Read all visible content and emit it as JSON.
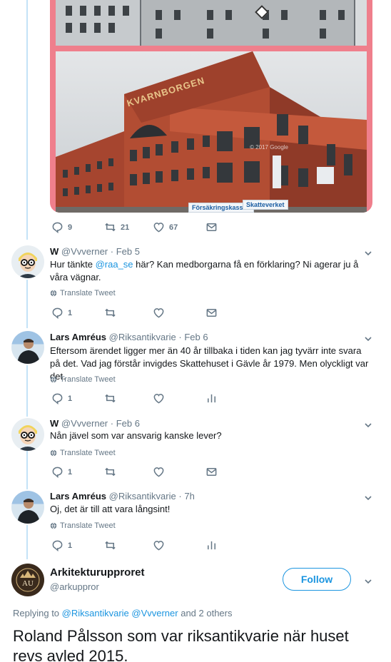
{
  "colors": {
    "accent": "#1b95e0",
    "muted": "#657786",
    "thread": "#c4e3f7",
    "card_bg": "#ef7f8c"
  },
  "photo": {
    "building_sign": "KVARNBORGEN",
    "watermark": "© 2017 Google",
    "shop_signs": [
      "Försäkringskassan",
      "Skatteverket"
    ]
  },
  "top_actions": {
    "reply_count": "9",
    "retweet_count": "21",
    "like_count": "67"
  },
  "tweets": [
    {
      "name": "W",
      "handle": "@Vvverner",
      "date": "Feb 5",
      "text_before": "Hur tänkte ",
      "mention": "@raa_se",
      "text_after": " här? Kan medborgarna få en förklaring? Ni agerar ju å våra vägnar.",
      "translate": "Translate Tweet",
      "reply_count": "1"
    },
    {
      "name": "Lars Amréus",
      "handle": "@Riksantikvarie",
      "date": "Feb 6",
      "text": "Eftersom ärendet ligger mer än 40 år tillbaka i tiden kan jag tyvärr inte svara på det. Vad jag förstår invigdes Skattehuset i Gävle år 1979. Men olyckligt var det.",
      "translate": "Translate Tweet",
      "reply_count": "1"
    },
    {
      "name": "W",
      "handle": "@Vvverner",
      "date": "Feb 6",
      "text": "Nån jävel som var ansvarig kanske lever?",
      "translate": "Translate Tweet",
      "reply_count": "1"
    },
    {
      "name": "Lars Amréus",
      "handle": "@Riksantikvarie",
      "date": "7h",
      "text": "Oj, det är till att vara långsint!",
      "translate": "Translate Tweet",
      "reply_count": "1"
    }
  ],
  "author": {
    "name": "Arkitekturupproret",
    "handle": "@arkuppror",
    "avatar_initials": "AU",
    "follow_label": "Follow"
  },
  "replying": {
    "prefix": "Replying to ",
    "mentions": "@Riksantikvarie @Vvverner",
    "suffix": " and 2 others"
  },
  "main_tweet": "Roland Pålsson som var riksantikvarie när huset revs avled 2015."
}
